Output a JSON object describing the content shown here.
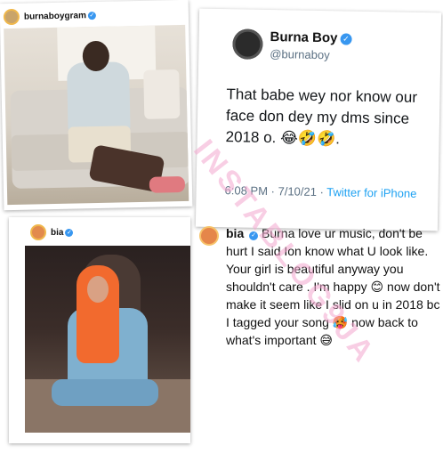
{
  "ig_post_1": {
    "handle": "burnaboygram",
    "verified_icon": "verified-badge"
  },
  "tweet": {
    "display_name": "Burna Boy",
    "username": "@burnaboy",
    "text": "That babe wey nor know our face don dey my dms since 2018 o. 😂🤣🤣.",
    "time": "6:08 PM · 7/10/21 · ",
    "source": "Twitter for iPhone"
  },
  "ig_post_2": {
    "handle": "bia",
    "verified_icon": "verified-badge"
  },
  "comment": {
    "author": "bia",
    "text": "Burna love ur music, don't be hurt I said Ion know what U look like. Your girl is beautiful anyway you shouldn't care . I'm happy 😊  now don't make it seem like I slid on u in 2018 bc I tagged your song 🥵 now back to what's important 😅"
  },
  "watermark": {
    "text": "INSTABLOG9JA"
  },
  "colors": {
    "verified": "#3897f0",
    "twitter_link": "#1da1f2",
    "watermark": "#f4a7cf"
  }
}
